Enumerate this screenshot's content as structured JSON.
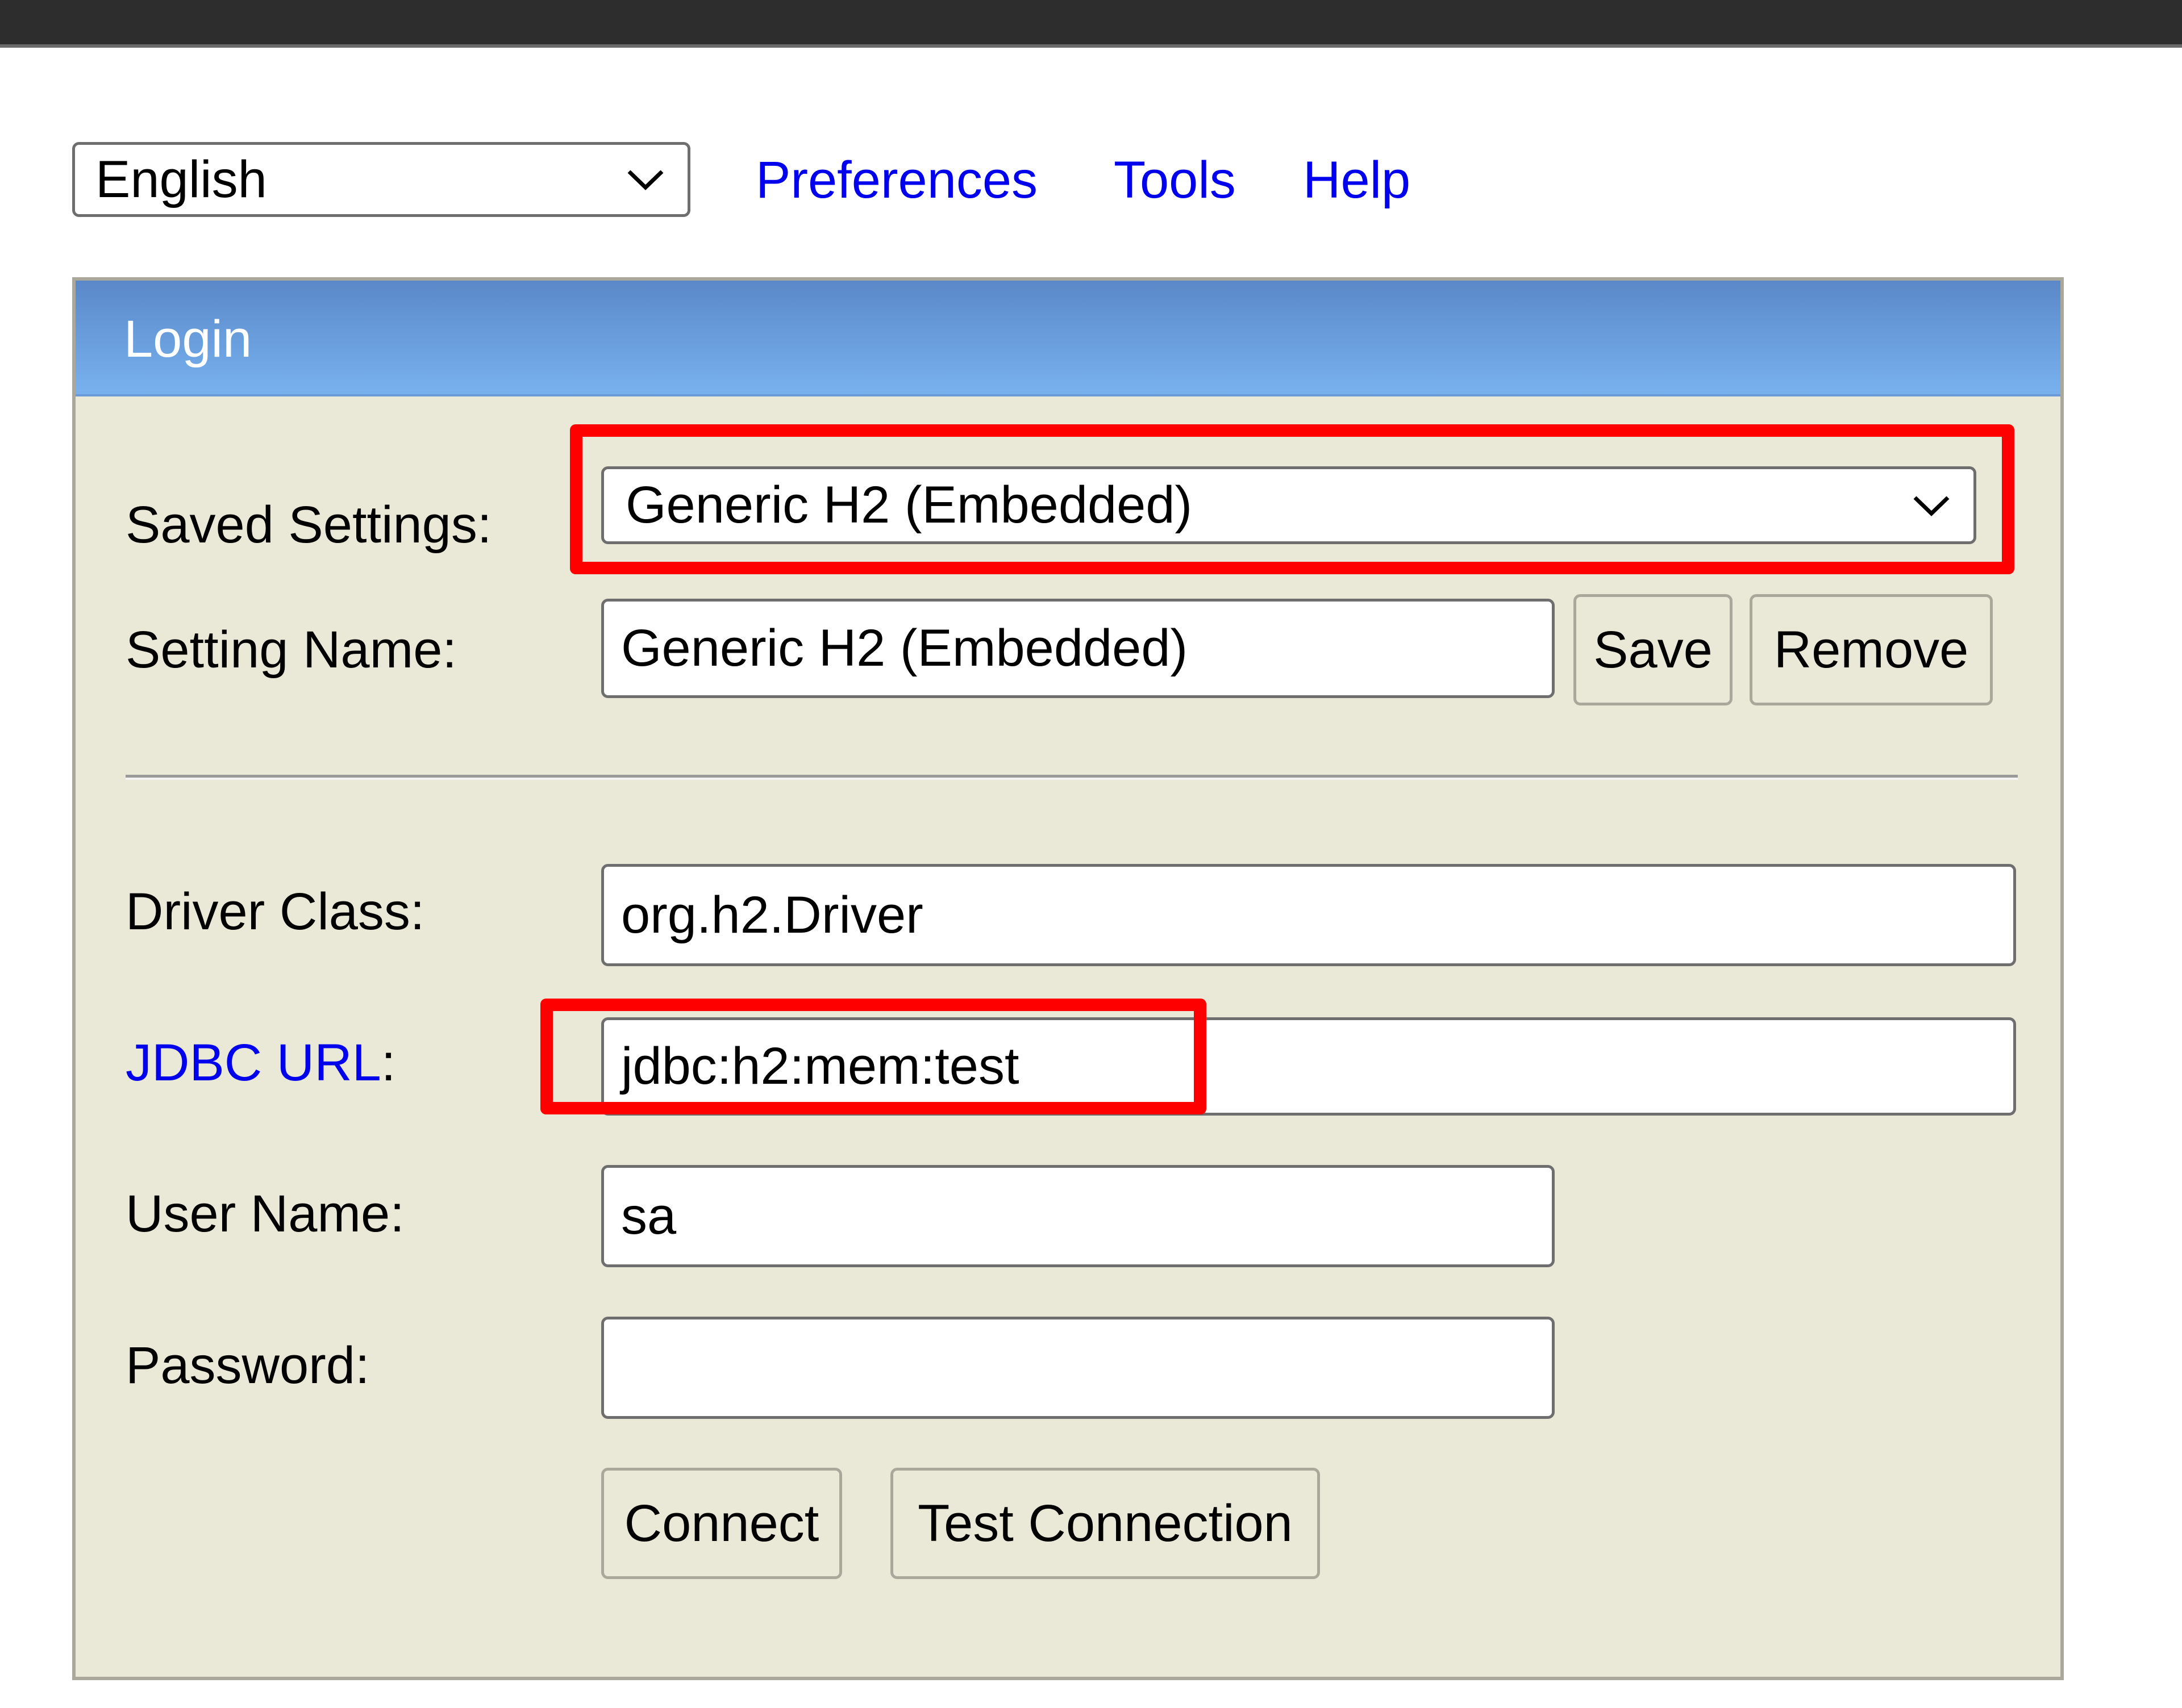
{
  "toolbar": {
    "language_select": {
      "value": "English",
      "icon": "chevron-down-icon"
    },
    "links": [
      {
        "label": "Preferences"
      },
      {
        "label": "Tools"
      },
      {
        "label": "Help"
      }
    ]
  },
  "login_panel": {
    "title": "Login",
    "saved_settings": {
      "label": "Saved Settings:",
      "value": "Generic H2 (Embedded)",
      "icon": "chevron-down-icon"
    },
    "setting_name": {
      "label": "Setting Name:",
      "value": "Generic H2 (Embedded)",
      "save_label": "Save",
      "remove_label": "Remove"
    },
    "driver_class": {
      "label": "Driver Class:",
      "value": "org.h2.Driver"
    },
    "jdbc_url": {
      "label_link": "JDBC URL",
      "label_suffix": ":",
      "value": "jdbc:h2:mem:test"
    },
    "user_name": {
      "label": "User Name:",
      "value": "sa"
    },
    "password": {
      "label": "Password:",
      "value": ""
    },
    "actions": {
      "connect_label": "Connect",
      "test_connection_label": "Test Connection"
    }
  },
  "colors": {
    "link": "#0000ee",
    "header_gradient_top": "#5b88c8",
    "header_gradient_bottom": "#79b1ef",
    "panel_background": "#eae9d8",
    "highlight": "#ff0000"
  }
}
